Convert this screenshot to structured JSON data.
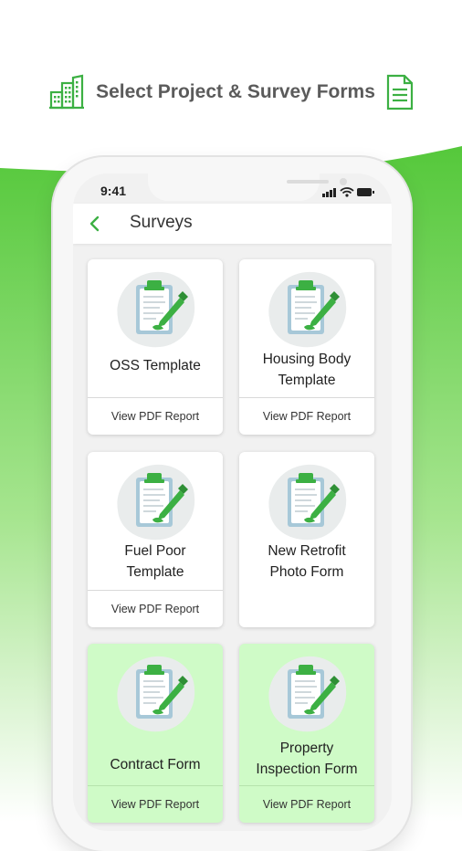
{
  "header": {
    "title": "Select Project & Survey Forms",
    "left_icon": "buildings-icon",
    "right_icon": "document-icon"
  },
  "colors": {
    "brand_green": "#3cb043",
    "bright_green": "#55c83b",
    "highlight_card": "#cffbc7"
  },
  "phone": {
    "status_time": "9:41",
    "app_title": "Surveys",
    "back_icon": "chevron-left-icon"
  },
  "surveys": [
    {
      "title": "OSS Template",
      "report_label": "View PDF Report",
      "highlighted": false,
      "has_report": true
    },
    {
      "title": "Housing Body\nTemplate",
      "report_label": "View PDF Report",
      "highlighted": false,
      "has_report": true
    },
    {
      "title": "Fuel Poor\nTemplate",
      "report_label": "View PDF Report",
      "highlighted": false,
      "has_report": true
    },
    {
      "title": "New Retrofit\nPhoto Form",
      "report_label": "",
      "highlighted": false,
      "has_report": false
    },
    {
      "title": "Contract Form",
      "report_label": "View PDF Report",
      "highlighted": true,
      "has_report": true
    },
    {
      "title": "Property\nInspection Form",
      "report_label": "View PDF Report",
      "highlighted": true,
      "has_report": true
    }
  ]
}
